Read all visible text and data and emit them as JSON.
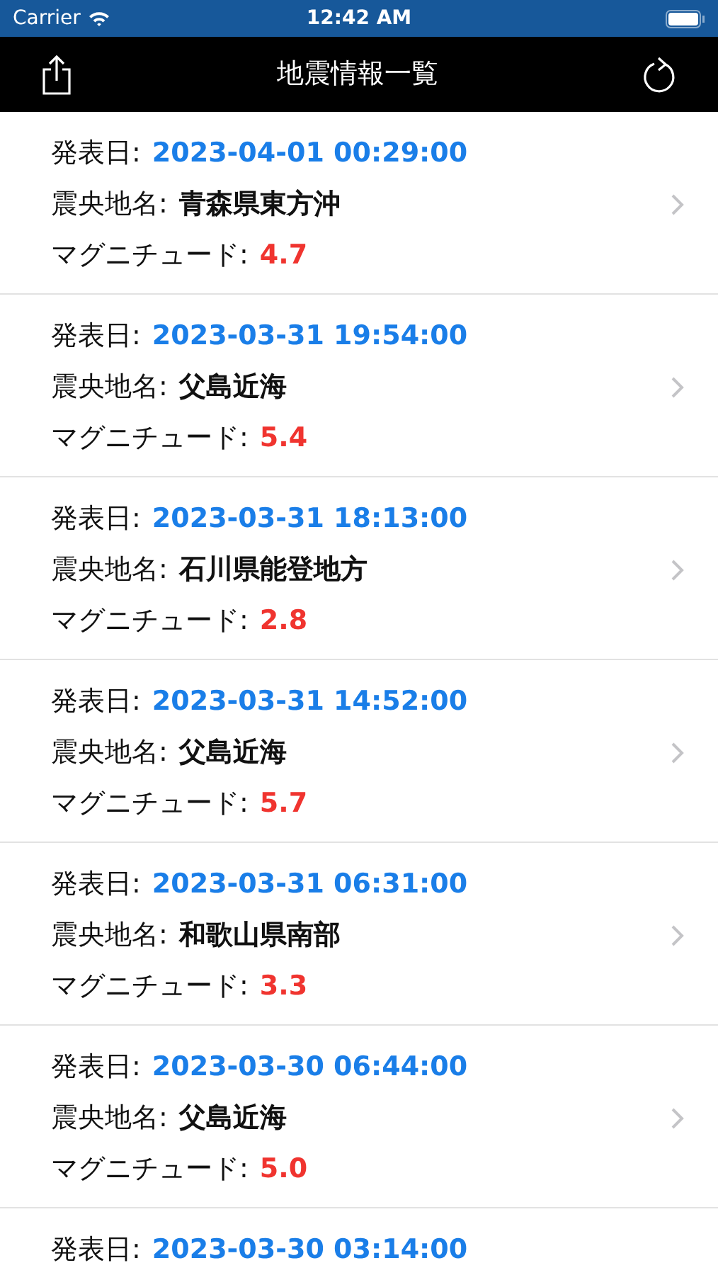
{
  "status_bar": {
    "carrier": "Carrier",
    "time": "12:42 AM"
  },
  "nav_bar": {
    "title": "地震情報一覧"
  },
  "rows": [
    {
      "date_label": "発表日:",
      "date": "2023-04-01 00:29:00",
      "place_label": "震央地名:",
      "place": "青森県東方沖",
      "magnitude_label": "マグニチュード:",
      "magnitude": "4.7"
    },
    {
      "date_label": "発表日:",
      "date": "2023-03-31 19:54:00",
      "place_label": "震央地名:",
      "place": "父島近海",
      "magnitude_label": "マグニチュード:",
      "magnitude": "5.4"
    },
    {
      "date_label": "発表日:",
      "date": "2023-03-31 18:13:00",
      "place_label": "震央地名:",
      "place": "石川県能登地方",
      "magnitude_label": "マグニチュード:",
      "magnitude": "2.8"
    },
    {
      "date_label": "発表日:",
      "date": "2023-03-31 14:52:00",
      "place_label": "震央地名:",
      "place": "父島近海",
      "magnitude_label": "マグニチュード:",
      "magnitude": "5.7"
    },
    {
      "date_label": "発表日:",
      "date": "2023-03-31 06:31:00",
      "place_label": "震央地名:",
      "place": "和歌山県南部",
      "magnitude_label": "マグニチュード:",
      "magnitude": "3.3"
    },
    {
      "date_label": "発表日:",
      "date": "2023-03-30 06:44:00",
      "place_label": "震央地名:",
      "place": "父島近海",
      "magnitude_label": "マグニチュード:",
      "magnitude": "5.0"
    },
    {
      "date_label": "発表日:",
      "date": "2023-03-30 03:14:00"
    }
  ]
}
